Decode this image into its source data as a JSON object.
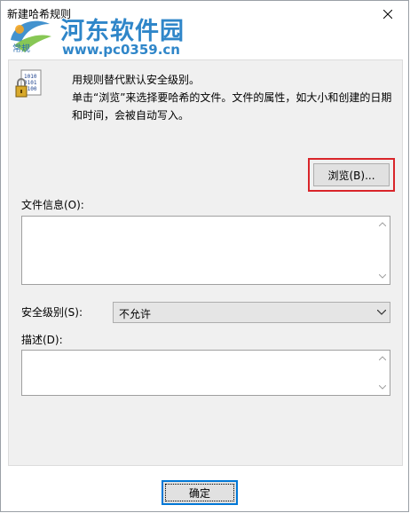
{
  "window": {
    "title": "新建哈希规则",
    "close_icon": "close-icon"
  },
  "watermark": {
    "brand": "河东软件园",
    "url": "www.pc0359.cn",
    "sub": "常规"
  },
  "description": {
    "line1": "用规则替代默认安全级别。",
    "line2": "单击“浏览”来选择要哈希的文件。文件的属性，如大小和创建的日期和时间，会被自动写入。"
  },
  "buttons": {
    "browse": "浏览(B)...",
    "ok": "确定"
  },
  "file_info": {
    "label": "文件信息(O):",
    "value": ""
  },
  "security": {
    "label": "安全级别(S):",
    "selected": "不允许"
  },
  "desc_field": {
    "label": "描述(D):",
    "value": ""
  },
  "colors": {
    "highlight": "#d9252a",
    "accent": "#0078d7",
    "watermark": "#2f86c9"
  }
}
